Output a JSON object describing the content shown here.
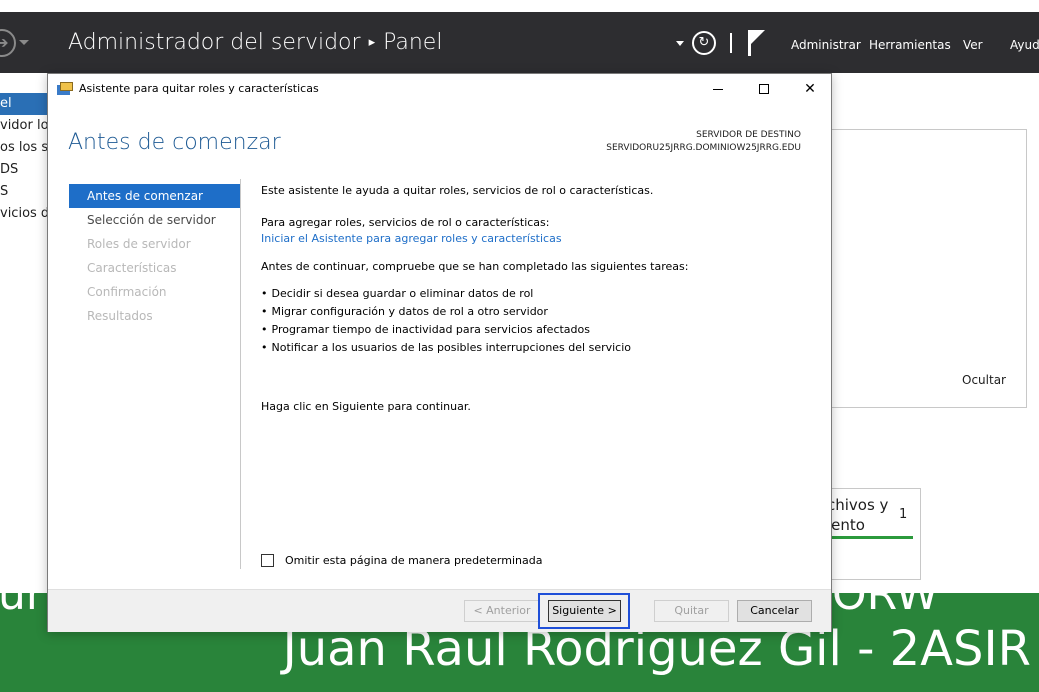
{
  "server_manager": {
    "title": "Administrador del servidor",
    "breadcrumb_sep": "▸",
    "page": "Panel",
    "menu": [
      "Administrar",
      "Herramientas",
      "Ver",
      "Ayuda"
    ],
    "nav_items": [
      "el",
      "vidor loc",
      "os los se",
      "DS",
      "S",
      "vicios de"
    ],
    "hide_label": "Ocultar",
    "tile": {
      "text": "chivos y\niento",
      "count": "1"
    },
    "accent_color": "#2a6fb5"
  },
  "wallpaper": {
    "line1_left": "ur",
    "line1_right": "ORW",
    "line2": "Juan Raul Rodriguez Gil - 2ASIR",
    "color": "#29843a"
  },
  "dialog": {
    "title": "Asistente para quitar roles y características",
    "heading": "Antes de comenzar",
    "dest_label": "SERVIDOR DE DESTINO",
    "dest_value": "SERVIDORU25JRRG.DOMINIOW25JRRG.EDU",
    "steps": [
      {
        "label": "Antes de comenzar",
        "state": "active"
      },
      {
        "label": "Selección de servidor",
        "state": "enabled"
      },
      {
        "label": "Roles de servidor",
        "state": "disabled"
      },
      {
        "label": "Características",
        "state": "disabled"
      },
      {
        "label": "Confirmación",
        "state": "disabled"
      },
      {
        "label": "Resultados",
        "state": "disabled"
      }
    ],
    "content": {
      "intro": "Este asistente le ayuda a quitar roles, servicios de rol o características.",
      "add_prompt": "Para agregar roles, servicios de rol o características:",
      "add_link": "Iniciar el Asistente para agregar roles y características",
      "before_continue": "Antes de continuar, compruebe que se han completado las siguientes tareas:",
      "tasks": [
        "Decidir si desea guardar o eliminar datos de rol",
        "Migrar configuración y datos de rol a otro servidor",
        "Programar tiempo de inactividad para servicios afectados",
        "Notificar a los usuarios de las posibles interrupciones del servicio"
      ],
      "click_next": "Haga clic en Siguiente para continuar."
    },
    "skip_checkbox": {
      "label": "Omitir esta página de manera predeterminada",
      "checked": false
    },
    "buttons": {
      "previous": "< Anterior",
      "next": "Siguiente >",
      "quit": "Quitar",
      "cancel": "Cancelar"
    },
    "heading_color": "#1e5a94",
    "active_step_color": "#1e6ec8",
    "highlight_color": "#1f4fd8"
  }
}
